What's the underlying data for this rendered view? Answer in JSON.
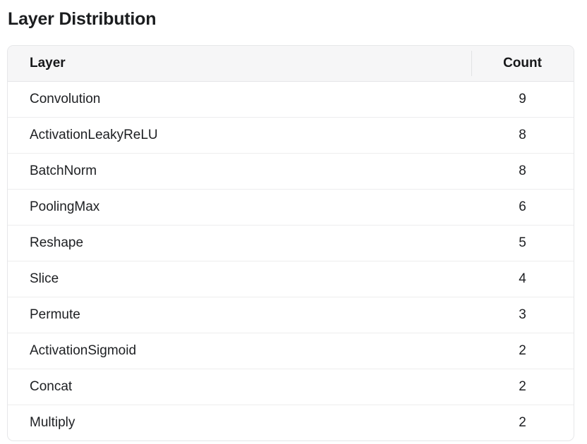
{
  "page": {
    "title": "Layer Distribution",
    "background_color": "#ffffff",
    "title_color": "#1b1d1f"
  },
  "table": {
    "border_color": "#e6e7e9",
    "header_background": "#f6f6f7",
    "row_separator_color": "#ededee",
    "columns": [
      {
        "key": "layer",
        "label": "Layer",
        "align": "left"
      },
      {
        "key": "count",
        "label": "Count",
        "align": "center"
      }
    ],
    "rows": [
      {
        "layer": "Convolution",
        "count": "9"
      },
      {
        "layer": "ActivationLeakyReLU",
        "count": "8"
      },
      {
        "layer": "BatchNorm",
        "count": "8"
      },
      {
        "layer": "PoolingMax",
        "count": "6"
      },
      {
        "layer": "Reshape",
        "count": "5"
      },
      {
        "layer": "Slice",
        "count": "4"
      },
      {
        "layer": "Permute",
        "count": "3"
      },
      {
        "layer": "ActivationSigmoid",
        "count": "2"
      },
      {
        "layer": "Concat",
        "count": "2"
      },
      {
        "layer": "Multiply",
        "count": "2"
      }
    ]
  },
  "chart_data": {
    "type": "table",
    "title": "Layer Distribution",
    "categories": [
      "Convolution",
      "ActivationLeakyReLU",
      "BatchNorm",
      "PoolingMax",
      "Reshape",
      "Slice",
      "Permute",
      "ActivationSigmoid",
      "Concat",
      "Multiply"
    ],
    "values": [
      9,
      8,
      8,
      6,
      5,
      4,
      3,
      2,
      2,
      2
    ],
    "xlabel": "Layer",
    "ylabel": "Count",
    "column_headers": [
      "Layer",
      "Count"
    ]
  }
}
